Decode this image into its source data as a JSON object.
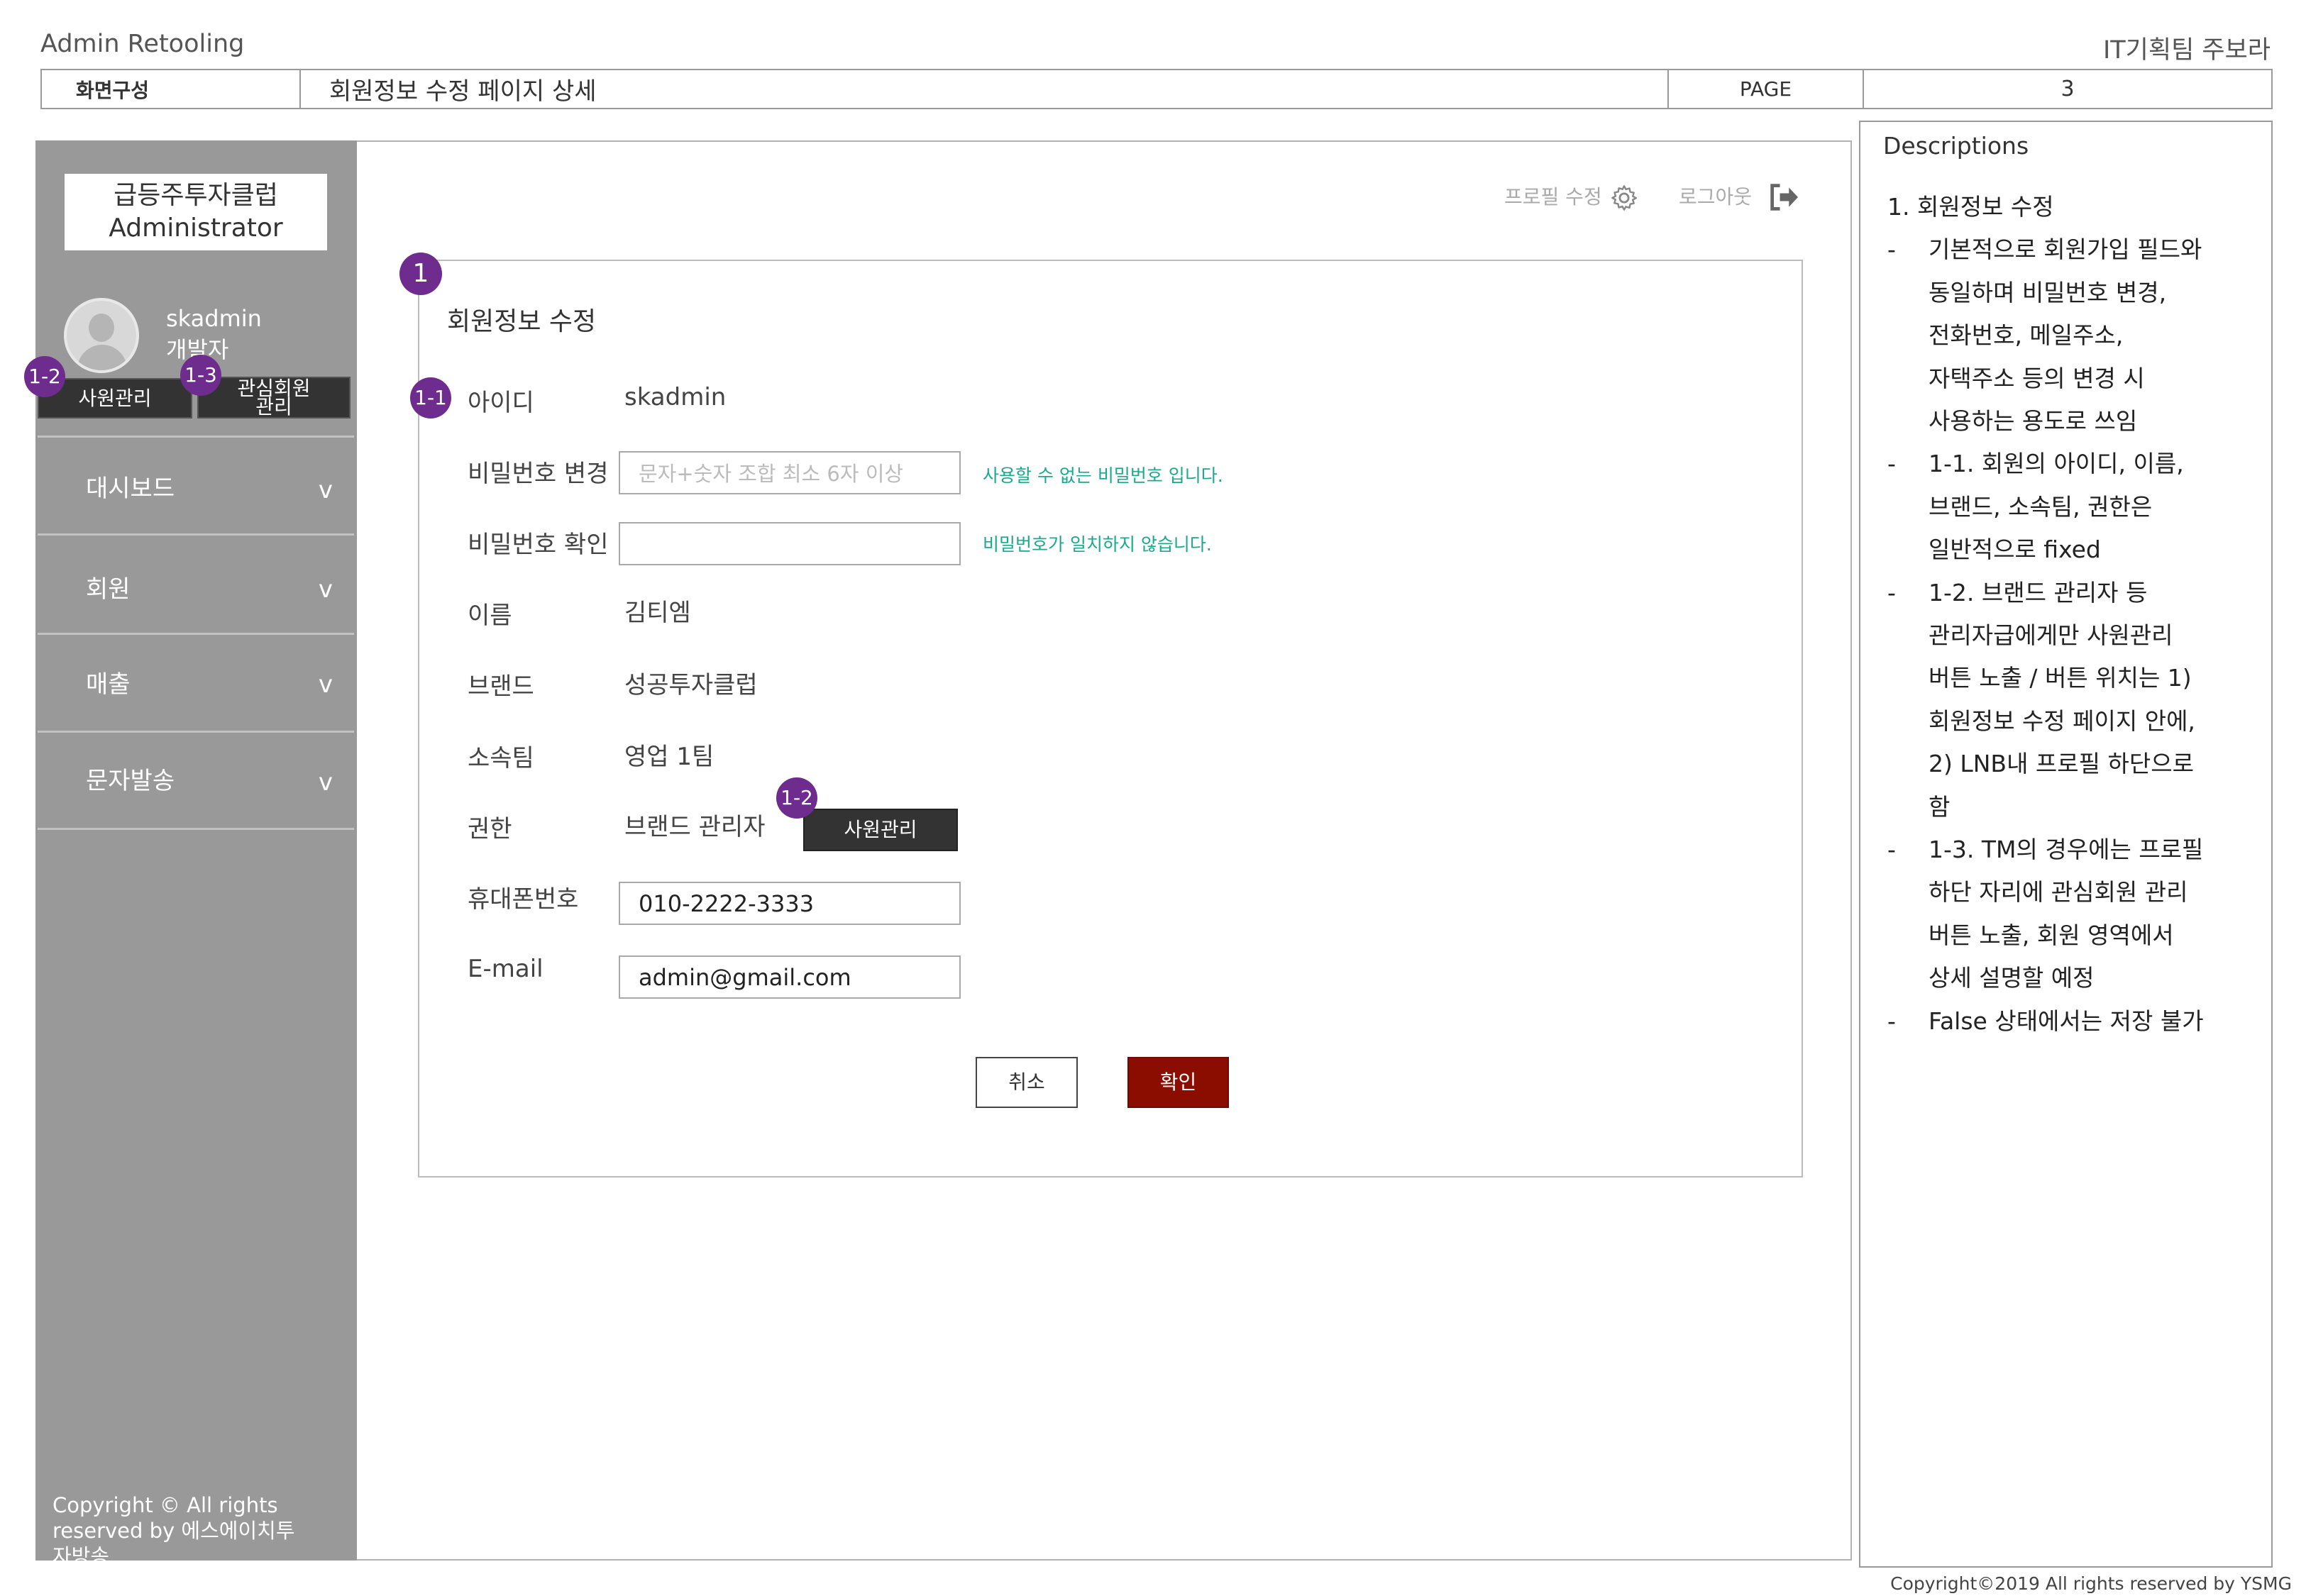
{
  "header": {
    "app_title": "Admin Retooling",
    "author": "IT기획팀 주보라",
    "section_label": "화면구성",
    "page_title": "회원정보 수정 페이지 상세",
    "page_label": "PAGE",
    "page_number": "3"
  },
  "sidebar": {
    "logo_line1": "급등주투자클럽",
    "logo_line2": "Administrator",
    "user_name": "skadmin",
    "user_role": "개발자",
    "btn_staff": "사원관리",
    "btn_interest_line1": "관심회원",
    "btn_interest_line2": "관리",
    "menu": [
      {
        "label": "대시보드",
        "chevron": "v"
      },
      {
        "label": "회원",
        "chevron": "v"
      },
      {
        "label": "매출",
        "chevron": "v"
      },
      {
        "label": "문자발송",
        "chevron": "v"
      }
    ],
    "copyright": "Copyright © All rights reserved by 에스에이치투자방송"
  },
  "topbar": {
    "profile_edit": "프로필 수정",
    "logout": "로그아웃"
  },
  "badges": {
    "b1": "1",
    "b1_1": "1-1",
    "b1_2": "1-2",
    "b1_3": "1-3"
  },
  "form": {
    "title": "회원정보 수정",
    "id_label": "아이디",
    "id_value": "skadmin",
    "pw_label": "비밀번호 변경",
    "pw_placeholder": "문자+숫자 조합 최소 6자 이상",
    "pw_hint": "사용할 수 없는 비밀번호 입니다.",
    "pw_confirm_label": "비밀번호 확인",
    "pw_confirm_hint": "비밀번호가 일치하지 않습니다.",
    "name_label": "이름",
    "name_value": "김티엠",
    "brand_label": "브랜드",
    "brand_value": "성공투자클럽",
    "team_label": "소속팀",
    "team_value": "영업 1팀",
    "role_label": "권한",
    "role_value": "브랜드 관리자",
    "role_button": "사원관리",
    "phone_label": "휴대폰번호",
    "phone_value": "010-2222-3333",
    "email_label": "E-mail",
    "email_value": "admin@gmail.com",
    "cancel_label": "취소",
    "confirm_label": "확인"
  },
  "descriptions": {
    "title": "Descriptions",
    "lines": [
      {
        "dash": "",
        "text": "1. 회원정보 수정"
      },
      {
        "dash": "-",
        "text": "기본적으로 회원가입 필드와"
      },
      {
        "dash": "",
        "text": "동일하며 비밀번호 변경,"
      },
      {
        "dash": "",
        "text": "전화번호, 메일주소,"
      },
      {
        "dash": "",
        "text": "자택주소 등의 변경 시"
      },
      {
        "dash": "",
        "text": "사용하는 용도로 쓰임"
      },
      {
        "dash": "-",
        "text": "1-1. 회원의 아이디, 이름,"
      },
      {
        "dash": "",
        "text": "브랜드, 소속팀, 권한은"
      },
      {
        "dash": "",
        "text": "일반적으로 fixed"
      },
      {
        "dash": "-",
        "text": "1-2. 브랜드 관리자 등"
      },
      {
        "dash": "",
        "text": "관리자급에게만 사원관리"
      },
      {
        "dash": "",
        "text": "버튼 노출 /  버튼 위치는 1)"
      },
      {
        "dash": "",
        "text": "회원정보 수정 페이지 안에,"
      },
      {
        "dash": "",
        "text": "2) LNB내 프로필 하단으로"
      },
      {
        "dash": "",
        "text": "함"
      },
      {
        "dash": "-",
        "text": "1-3. TM의 경우에는 프로필"
      },
      {
        "dash": "",
        "text": "하단 자리에 관심회원 관리"
      },
      {
        "dash": "",
        "text": "버튼 노출, 회원 영역에서"
      },
      {
        "dash": "",
        "text": "상세 설명할 예정"
      },
      {
        "dash": "-",
        "text": "False 상태에서는 저장 불가"
      }
    ]
  },
  "footer": {
    "copyright": "Copyright©2019 All rights reserved by YSMG"
  }
}
